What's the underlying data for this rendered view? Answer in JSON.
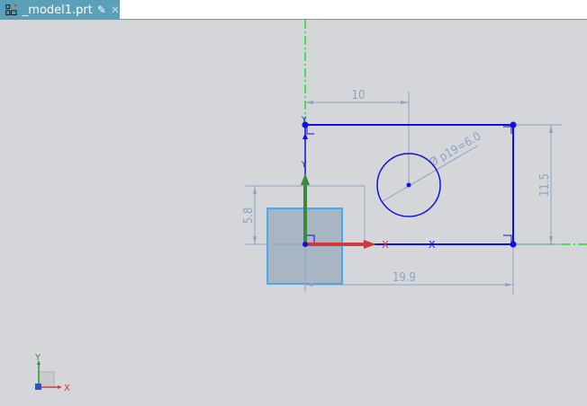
{
  "tab": {
    "title": "_model1.prt",
    "icon": "part-file-icon",
    "edit_icon": "edit-icon",
    "close_icon": "close-icon"
  },
  "sketch": {
    "dimensions": {
      "horizontal_10": "10",
      "vertical_11_5": "11.5",
      "vertical_5_8": "5.8",
      "horizontal_19_9": "19.9",
      "diameter": "Ø p19=6.0"
    },
    "axis_labels": {
      "x": "X",
      "y": "Y"
    }
  },
  "triad": {
    "x": "X",
    "y": "Y"
  },
  "colors": {
    "tab": "#5b9fb8",
    "background": "#d4d6d9",
    "sketch_curve": "#1010e0",
    "dimension": "#8aa4c4",
    "datum": "#22dd22"
  }
}
